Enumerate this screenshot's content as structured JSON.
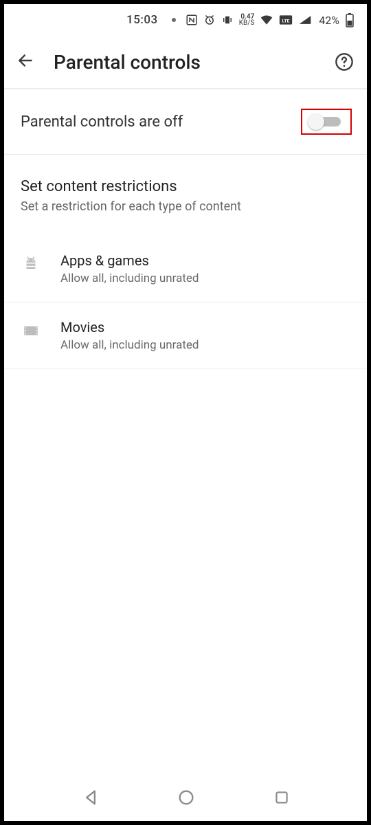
{
  "status": {
    "time": "15:03",
    "network_speed": "0.47",
    "network_unit": "KB/S",
    "volte_label": "LTE",
    "battery_pct": "42%"
  },
  "appbar": {
    "title": "Parental controls"
  },
  "toggle": {
    "label": "Parental controls are off",
    "on": false
  },
  "section": {
    "title": "Set content restrictions",
    "subtitle": "Set a restriction for each type of content"
  },
  "items": [
    {
      "title": "Apps & games",
      "subtitle": "Allow all, including unrated"
    },
    {
      "title": "Movies",
      "subtitle": "Allow all, including unrated"
    }
  ]
}
